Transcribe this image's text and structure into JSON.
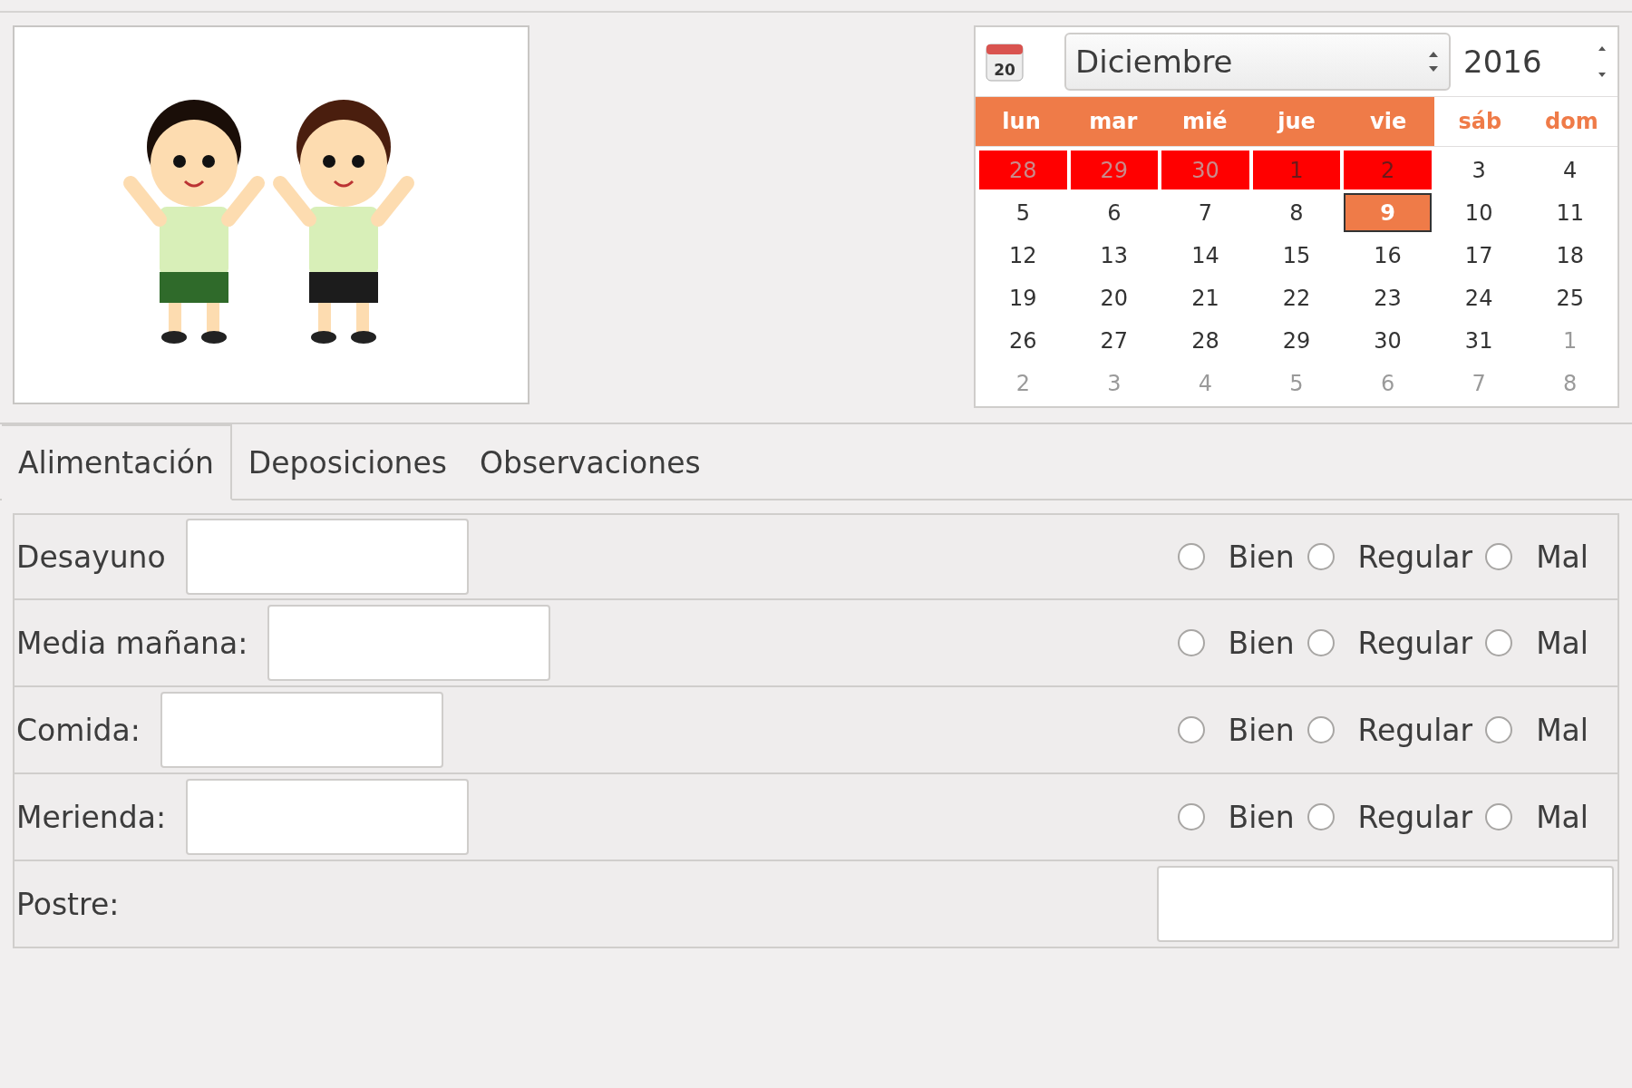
{
  "calendar": {
    "icon_text": "20",
    "month": "Diciembre",
    "year": "2016",
    "weekdays": [
      {
        "label": "lun",
        "weekend": false
      },
      {
        "label": "mar",
        "weekend": false
      },
      {
        "label": "mié",
        "weekend": false
      },
      {
        "label": "jue",
        "weekend": false
      },
      {
        "label": "vie",
        "weekend": false
      },
      {
        "label": "sáb",
        "weekend": true
      },
      {
        "label": "dom",
        "weekend": true
      }
    ],
    "days": [
      {
        "label": "28",
        "other_month": true,
        "marked": true,
        "selected": false
      },
      {
        "label": "29",
        "other_month": true,
        "marked": true,
        "selected": false
      },
      {
        "label": "30",
        "other_month": true,
        "marked": true,
        "selected": false
      },
      {
        "label": "1",
        "other_month": false,
        "marked": true,
        "selected": false
      },
      {
        "label": "2",
        "other_month": false,
        "marked": true,
        "selected": false
      },
      {
        "label": "3",
        "other_month": false,
        "marked": false,
        "selected": false
      },
      {
        "label": "4",
        "other_month": false,
        "marked": false,
        "selected": false
      },
      {
        "label": "5",
        "other_month": false,
        "marked": false,
        "selected": false
      },
      {
        "label": "6",
        "other_month": false,
        "marked": false,
        "selected": false
      },
      {
        "label": "7",
        "other_month": false,
        "marked": false,
        "selected": false
      },
      {
        "label": "8",
        "other_month": false,
        "marked": false,
        "selected": false
      },
      {
        "label": "9",
        "other_month": false,
        "marked": false,
        "selected": true
      },
      {
        "label": "10",
        "other_month": false,
        "marked": false,
        "selected": false
      },
      {
        "label": "11",
        "other_month": false,
        "marked": false,
        "selected": false
      },
      {
        "label": "12",
        "other_month": false,
        "marked": false,
        "selected": false
      },
      {
        "label": "13",
        "other_month": false,
        "marked": false,
        "selected": false
      },
      {
        "label": "14",
        "other_month": false,
        "marked": false,
        "selected": false
      },
      {
        "label": "15",
        "other_month": false,
        "marked": false,
        "selected": false
      },
      {
        "label": "16",
        "other_month": false,
        "marked": false,
        "selected": false
      },
      {
        "label": "17",
        "other_month": false,
        "marked": false,
        "selected": false
      },
      {
        "label": "18",
        "other_month": false,
        "marked": false,
        "selected": false
      },
      {
        "label": "19",
        "other_month": false,
        "marked": false,
        "selected": false
      },
      {
        "label": "20",
        "other_month": false,
        "marked": false,
        "selected": false
      },
      {
        "label": "21",
        "other_month": false,
        "marked": false,
        "selected": false
      },
      {
        "label": "22",
        "other_month": false,
        "marked": false,
        "selected": false
      },
      {
        "label": "23",
        "other_month": false,
        "marked": false,
        "selected": false
      },
      {
        "label": "24",
        "other_month": false,
        "marked": false,
        "selected": false
      },
      {
        "label": "25",
        "other_month": false,
        "marked": false,
        "selected": false
      },
      {
        "label": "26",
        "other_month": false,
        "marked": false,
        "selected": false
      },
      {
        "label": "27",
        "other_month": false,
        "marked": false,
        "selected": false
      },
      {
        "label": "28",
        "other_month": false,
        "marked": false,
        "selected": false
      },
      {
        "label": "29",
        "other_month": false,
        "marked": false,
        "selected": false
      },
      {
        "label": "30",
        "other_month": false,
        "marked": false,
        "selected": false
      },
      {
        "label": "31",
        "other_month": false,
        "marked": false,
        "selected": false
      },
      {
        "label": "1",
        "other_month": true,
        "marked": false,
        "selected": false
      },
      {
        "label": "2",
        "other_month": true,
        "marked": false,
        "selected": false
      },
      {
        "label": "3",
        "other_month": true,
        "marked": false,
        "selected": false
      },
      {
        "label": "4",
        "other_month": true,
        "marked": false,
        "selected": false
      },
      {
        "label": "5",
        "other_month": true,
        "marked": false,
        "selected": false
      },
      {
        "label": "6",
        "other_month": true,
        "marked": false,
        "selected": false
      },
      {
        "label": "7",
        "other_month": true,
        "marked": false,
        "selected": false
      },
      {
        "label": "8",
        "other_month": true,
        "marked": false,
        "selected": false
      }
    ]
  },
  "tabs": [
    {
      "label": "Alimentación",
      "selected": true
    },
    {
      "label": "Deposiciones",
      "selected": false
    },
    {
      "label": "Observaciones",
      "selected": false
    }
  ],
  "rows": [
    {
      "kind": "rated",
      "label": "Desayuno",
      "options": [
        {
          "label": "Bien",
          "selected": false
        },
        {
          "label": "Regular",
          "selected": false
        },
        {
          "label": "Mal",
          "selected": false
        }
      ]
    },
    {
      "kind": "rated",
      "label": "Media mañana:",
      "options": [
        {
          "label": "Bien",
          "selected": false
        },
        {
          "label": "Regular",
          "selected": false
        },
        {
          "label": "Mal",
          "selected": false
        }
      ]
    },
    {
      "kind": "rated",
      "label": "Comida:",
      "options": [
        {
          "label": "Bien",
          "selected": false
        },
        {
          "label": "Regular",
          "selected": false
        },
        {
          "label": "Mal",
          "selected": false
        }
      ]
    },
    {
      "kind": "rated",
      "label": "Merienda:",
      "options": [
        {
          "label": "Bien",
          "selected": false
        },
        {
          "label": "Regular",
          "selected": false
        },
        {
          "label": "Mal",
          "selected": false
        }
      ]
    },
    {
      "kind": "plain",
      "label": "Postre:"
    }
  ]
}
